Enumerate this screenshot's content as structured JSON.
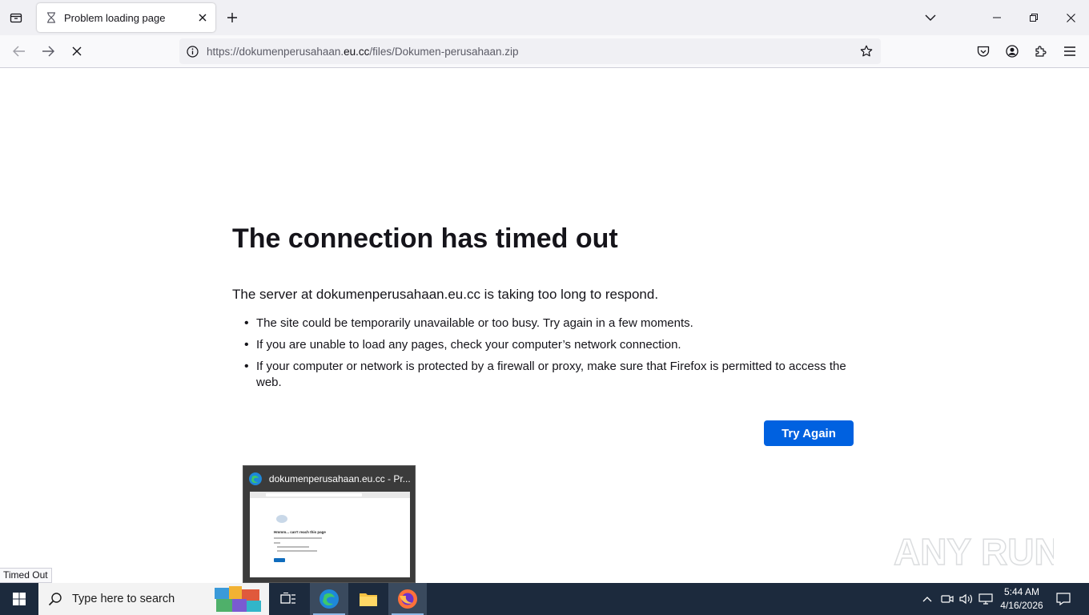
{
  "browser": {
    "tab": {
      "title": "Problem loading page"
    },
    "url": {
      "prefix": "https://dokumenperusahaan.",
      "host": "eu.cc",
      "path": "/files/Dokumen-perusahaan.zip"
    }
  },
  "error": {
    "title": "The connection has timed out",
    "description": "The server at dokumenperusahaan.eu.cc is taking too long to respond.",
    "bullets": [
      "The site could be temporarily unavailable or too busy. Try again in a few moments.",
      "If you are unable to load any pages, check your computer’s network connection.",
      "If your computer or network is protected by a firewall or proxy, make sure that Firefox is permitted to access the web."
    ],
    "try_again_label": "Try Again"
  },
  "status_text": "Timed Out",
  "thumbnail": {
    "title": "dokumenperusahaan.eu.cc - Pr...",
    "mini_heading": "Hmmm... can't reach this page"
  },
  "watermark": {
    "text": "ANY RUN"
  },
  "taskbar": {
    "search_placeholder": "Type here to search",
    "time": "5:44 AM",
    "date": "4/16/2026"
  },
  "colors": {
    "accent": "#0061e0",
    "taskbar": "#1c2a3d",
    "chrome": "#f0f0f4"
  }
}
